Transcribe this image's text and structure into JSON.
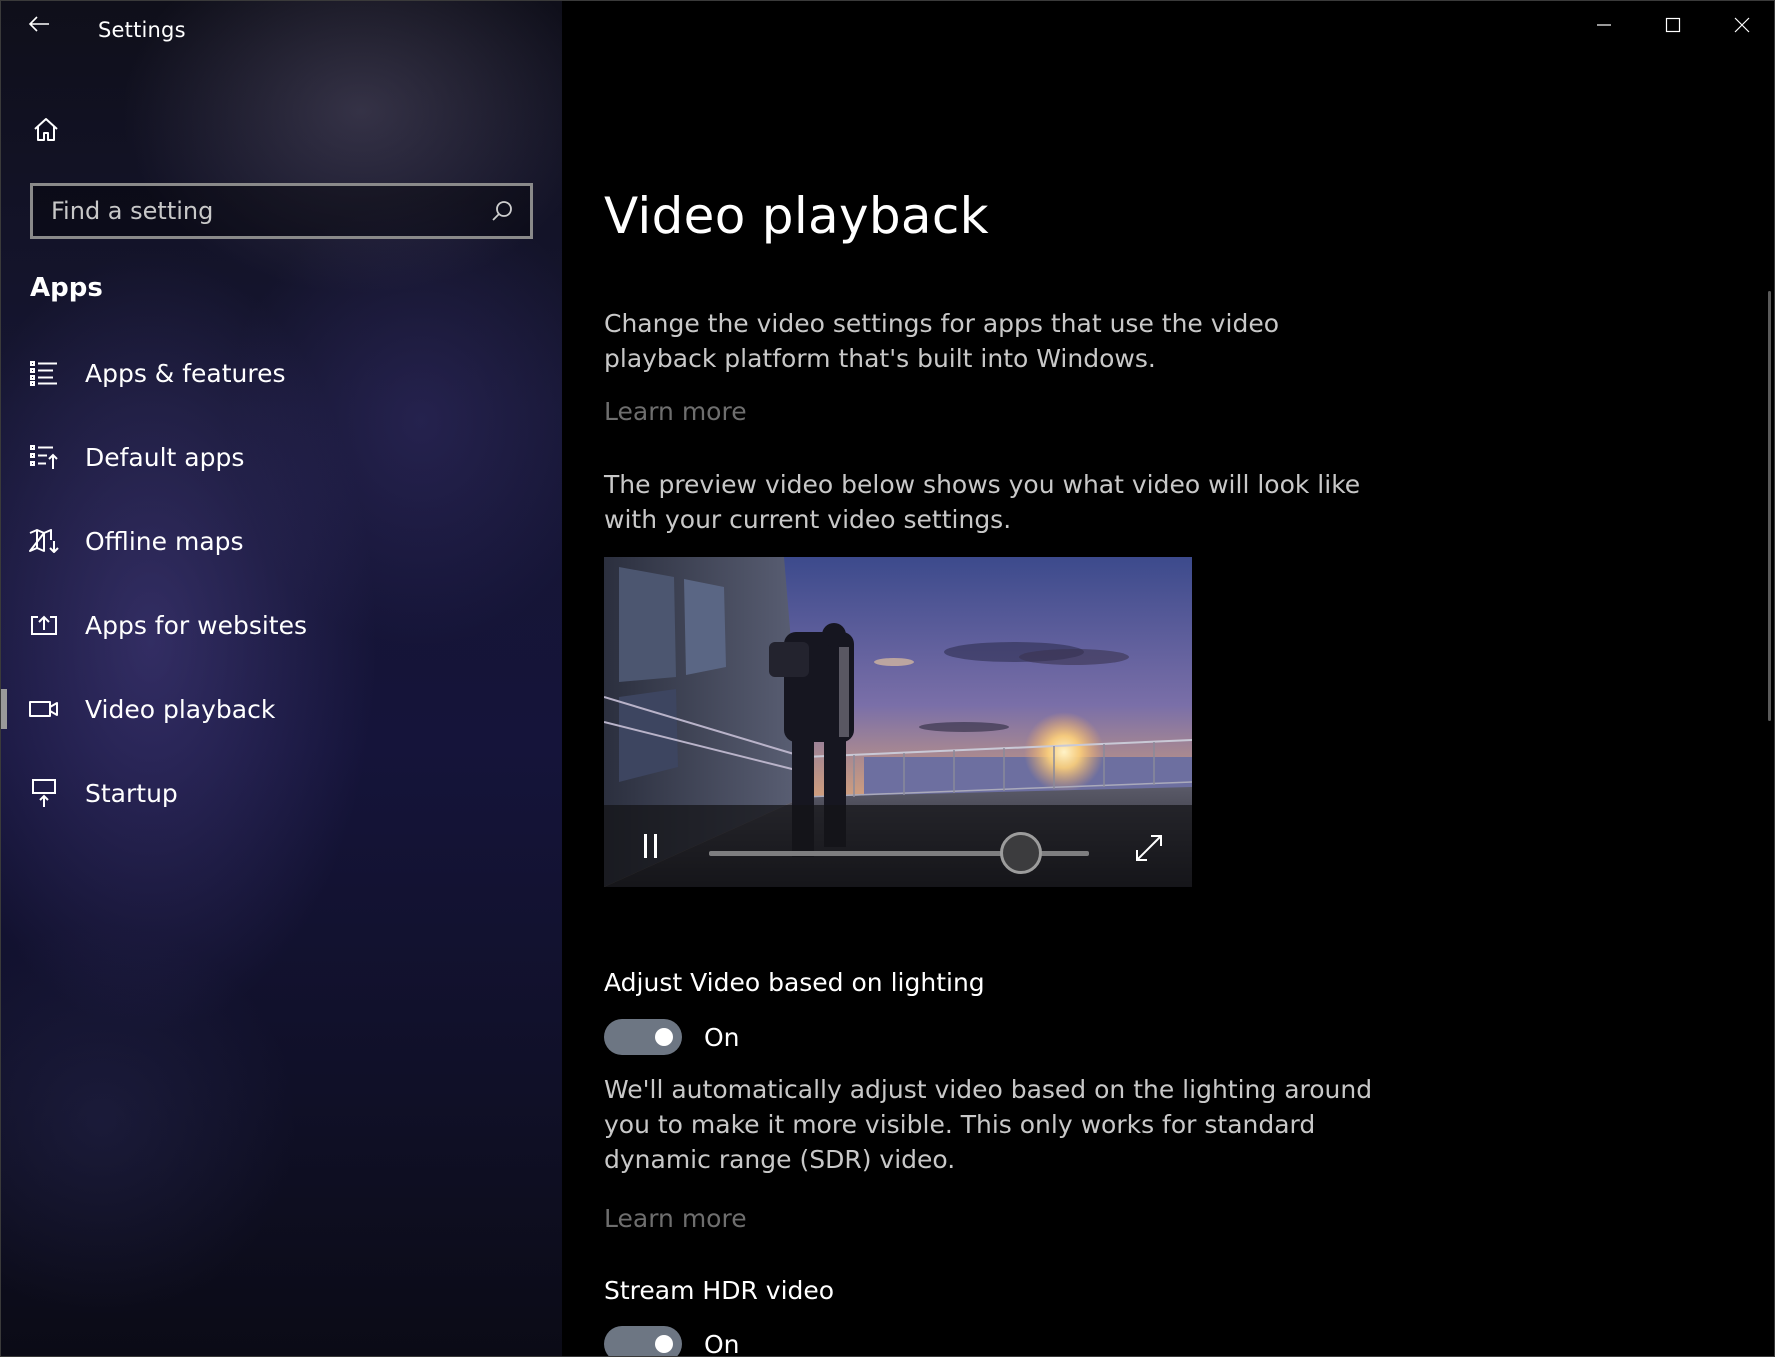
{
  "window": {
    "title": "Settings"
  },
  "sidebar": {
    "search_placeholder": "Find a setting",
    "section_title": "Apps",
    "items": [
      {
        "label": "Apps & features",
        "icon": "apps-features-icon"
      },
      {
        "label": "Default apps",
        "icon": "default-apps-icon"
      },
      {
        "label": "Offline maps",
        "icon": "offline-maps-icon"
      },
      {
        "label": "Apps for websites",
        "icon": "apps-for-websites-icon"
      },
      {
        "label": "Video playback",
        "icon": "video-camera-icon",
        "selected": true
      },
      {
        "label": "Startup",
        "icon": "startup-icon"
      }
    ]
  },
  "main": {
    "title": "Video playback",
    "intro": "Change the video settings for apps that use the video playback platform that's built into Windows.",
    "learn_more_1": "Learn more",
    "preview_text": "The preview video below shows you what video will look like with your current video settings.",
    "video": {
      "progress": 0.82
    },
    "adjust_lighting": {
      "label": "Adjust Video based on lighting",
      "state": "On",
      "description": "We'll automatically adjust video based on the lighting around you to make it more visible. This only works for standard dynamic range (SDR) video.",
      "learn_more": "Learn more"
    },
    "stream_hdr": {
      "label": "Stream HDR video",
      "state": "On"
    }
  },
  "colors": {
    "toggle_on": "#6d7683",
    "link": "#6e6e6e",
    "body_text": "#c8c8c8"
  }
}
